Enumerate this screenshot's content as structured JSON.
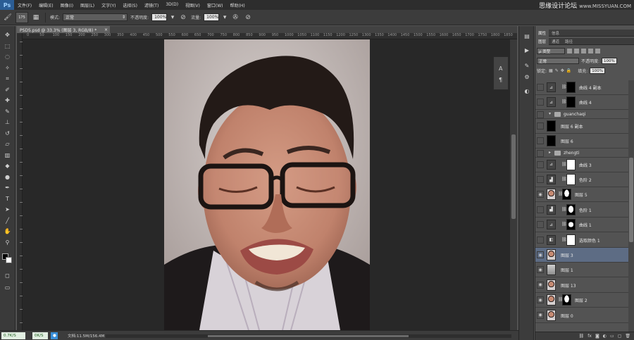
{
  "app": {
    "logo": "Ps",
    "menus": [
      "文件(F)",
      "编辑(E)",
      "图像(I)",
      "图层(L)",
      "文字(Y)",
      "选择(S)",
      "滤镜(T)",
      "3D(D)",
      "视图(V)",
      "窗口(W)",
      "帮助(H)"
    ],
    "watermark": "思缘设计论坛",
    "watermark_site": "www.MISSYUAN.COM"
  },
  "options_bar": {
    "brush_size": "175",
    "mode_label": "模式:",
    "mode_value": "正常",
    "opacity_label": "不透明度:",
    "opacity_value": "100%",
    "flow_label": "流量:",
    "flow_value": "100%"
  },
  "document": {
    "tab_title": "PSD5.psd @ 33.3% (图层 3, RGB/8) *",
    "tab_close": "×",
    "ruler_ticks": [
      "0",
      "50",
      "100",
      "150",
      "200",
      "250",
      "300",
      "350",
      "400",
      "450",
      "500",
      "550",
      "600",
      "650",
      "700",
      "750",
      "800",
      "850",
      "900",
      "950",
      "1000",
      "1050",
      "1100",
      "1150",
      "1200",
      "1250",
      "1300",
      "1350",
      "1400",
      "1450",
      "1500",
      "1550",
      "1600",
      "1650",
      "1700",
      "1750",
      "1800",
      "1850"
    ]
  },
  "status": {
    "net_up": "0.7K/S",
    "net_down": "0K/S",
    "doc_info": "文档:11.5M/156.4M"
  },
  "panels": {
    "top_tabs": [
      "属性",
      "信息"
    ],
    "layer_tabs": [
      "图层",
      "通道",
      "路径"
    ],
    "filter_label": "ρ 类型",
    "blend_mode": "正常",
    "opacity_label": "不透明度:",
    "opacity_value": "100%",
    "lock_label": "锁定:",
    "fill_label": "填充:",
    "fill_value": "100%"
  },
  "layers": [
    {
      "name": "曲线 4 副本",
      "kind": "adj",
      "adj_icon": "⊿",
      "mask": "black"
    },
    {
      "name": "曲线 4",
      "kind": "adj",
      "adj_icon": "⊿",
      "mask": "black"
    },
    {
      "name": "guanchaqi",
      "kind": "group",
      "expanded": true
    },
    {
      "name": "图层 6 副本",
      "kind": "pixel",
      "thumb": "black"
    },
    {
      "name": "图层 6",
      "kind": "pixel",
      "thumb": "black"
    },
    {
      "name": "zhengti",
      "kind": "group",
      "expanded": false
    },
    {
      "name": "曲线 3",
      "kind": "adj",
      "adj_icon": "⊿",
      "mask": "white"
    },
    {
      "name": "色阶 2",
      "kind": "adj",
      "adj_icon": "▟",
      "mask": "white"
    },
    {
      "name": "图层 5",
      "kind": "pixel-mask",
      "thumb": "face",
      "mask": "shape"
    },
    {
      "name": "色阶 1",
      "kind": "adj",
      "adj_icon": "▟",
      "mask": "shape-dark"
    },
    {
      "name": "曲线 1",
      "kind": "adj",
      "adj_icon": "⊿",
      "mask": "circle"
    },
    {
      "name": "选取颜色 1",
      "kind": "adj",
      "adj_icon": "◧",
      "mask": "white"
    },
    {
      "name": "图层 3",
      "kind": "pixel",
      "thumb": "face",
      "selected": true
    },
    {
      "name": "图层 1",
      "kind": "pixel",
      "thumb": "gray"
    },
    {
      "name": "图层 13",
      "kind": "pixel",
      "thumb": "face"
    },
    {
      "name": "图层 2",
      "kind": "pixel-mask",
      "thumb": "face",
      "mask": "shape"
    },
    {
      "name": "图层 0",
      "kind": "pixel",
      "thumb": "face"
    }
  ],
  "colors": {
    "selected_row": "#5d6c84",
    "canvas_bg": "#282828",
    "ui_dark": "#3c3c3c"
  }
}
